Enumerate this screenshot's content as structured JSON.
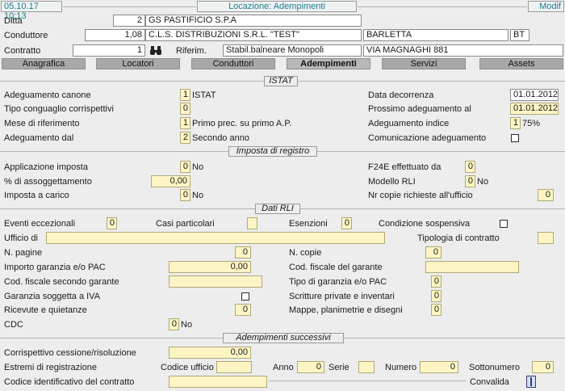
{
  "topbar": {
    "datetime": "05.10.17 10:13",
    "title": "Locazione: Adempimenti",
    "mode": "Modif"
  },
  "header": {
    "ditta_label": "Ditta",
    "ditta_code": "2",
    "ditta_name": "GS PASTIFICIO S.P.A",
    "conduttore_label": "Conduttore",
    "conduttore_code": "1,08",
    "conduttore_name": "C.L.S. DISTRIBUZIONI S.R.L. \"TEST\"",
    "conduttore_city": "BARLETTA",
    "conduttore_prov": "BT",
    "contratto_label": "Contratto",
    "contratto_num": "1",
    "riferim_label": "Riferim.",
    "riferim_value": "Stabil.balneare Monopoli",
    "riferim_address": "VIA MAGNAGHI 881"
  },
  "tabs": [
    {
      "label": "Anagrafica"
    },
    {
      "label": "Locatori"
    },
    {
      "label": "Conduttori"
    },
    {
      "label": "Adempimenti"
    },
    {
      "label": "Servizi"
    },
    {
      "label": "Assets"
    }
  ],
  "istat": {
    "title": "ISTAT",
    "adeguamento_canone_label": "Adeguamento canone",
    "adeguamento_canone_val": "1",
    "adeguamento_canone_desc": "ISTAT",
    "tipo_conguaglio_label": "Tipo conguaglio corrispettivi",
    "tipo_conguaglio_val": "0",
    "mese_label": "Mese di riferimento",
    "mese_val": "1",
    "mese_desc": "Primo prec. su primo A.P.",
    "adeg_dal_label": "Adeguamento dal",
    "adeg_dal_val": "2",
    "adeg_dal_desc": "Secondo anno",
    "data_decorrenza_label": "Data decorrenza",
    "data_decorrenza_val": "01.01.2012",
    "prossimo_label": "Prossimo adeguamento al",
    "prossimo_val": "01.01.2012",
    "adeg_indice_label": "Adeguamento indice",
    "adeg_indice_val": "1",
    "adeg_indice_desc": "75%",
    "comunicazione_label": "Comunicazione adeguamento"
  },
  "registro": {
    "title": "Imposta di registro",
    "applicazione_label": "Applicazione imposta",
    "applicazione_val": "0",
    "applicazione_desc": "No",
    "assoggettamento_label": "% di assoggettamento",
    "assoggettamento_val": "0,00",
    "carico_label": "Imposta a carico",
    "carico_val": "0",
    "carico_desc": "No",
    "f24e_label": "F24E effettuato da",
    "f24e_val": "0",
    "modello_label": "Modello RLI",
    "modello_val": "0",
    "modello_desc": "No",
    "copie_label": "Nr copie richieste all'ufficio",
    "copie_val": "0"
  },
  "rli": {
    "title": "Dati RLI",
    "eventi_label": "Eventi eccezionali",
    "eventi_val": "0",
    "casi_label": "Casi particolari",
    "casi_val": "",
    "esenzioni_label": "Esenzioni",
    "esenzioni_val": "0",
    "condizione_label": "Condizione sospensiva",
    "ufficio_label": "Ufficio di",
    "ufficio_val": "",
    "tipologia_label": "Tipologia di contratto",
    "tipologia_val": "",
    "pagine_label": "N. pagine",
    "pagine_val": "0",
    "ncopie_label": "N. copie",
    "ncopie_val": "0",
    "garanzia_label": "Importo garanzia e/o PAC",
    "garanzia_val": "0,00",
    "cf_garante_label": "Cod. fiscale del garante",
    "cf_garante_val": "",
    "cf_secondo_label": "Cod. fiscale secondo garante",
    "cf_secondo_val": "",
    "tipo_garanzia_label": "Tipo di garanzia e/o PAC",
    "tipo_garanzia_val": "0",
    "garanzia_iva_label": "Garanzia soggetta a IVA",
    "scritture_label": "Scritture private e inventari",
    "scritture_val": "0",
    "ricevute_label": "Ricevute e quietanze",
    "ricevute_val": "0",
    "mappe_label": "Mappe, planimetrie e disegni",
    "mappe_val": "0",
    "cdc_label": "CDC",
    "cdc_val": "0",
    "cdc_desc": "No"
  },
  "successivi": {
    "title": "Adempimenti successivi",
    "corrispettivo_label": "Corrispettivo cessione/risoluzione",
    "corrispettivo_val": "0,00",
    "estremi_label": "Estremi di registrazione",
    "codice_ufficio_label": "Codice ufficio",
    "codice_ufficio_val": "",
    "anno_label": "Anno",
    "anno_val": "0",
    "serie_label": "Serie",
    "serie_val": "",
    "numero_label": "Numero",
    "numero_val": "0",
    "sottonumero_label": "Sottonumero",
    "sottonumero_val": "0",
    "codice_contratto_label": "Codice identificativo del contratto",
    "codice_contratto_val": "",
    "convalida_label": "Convalida"
  }
}
